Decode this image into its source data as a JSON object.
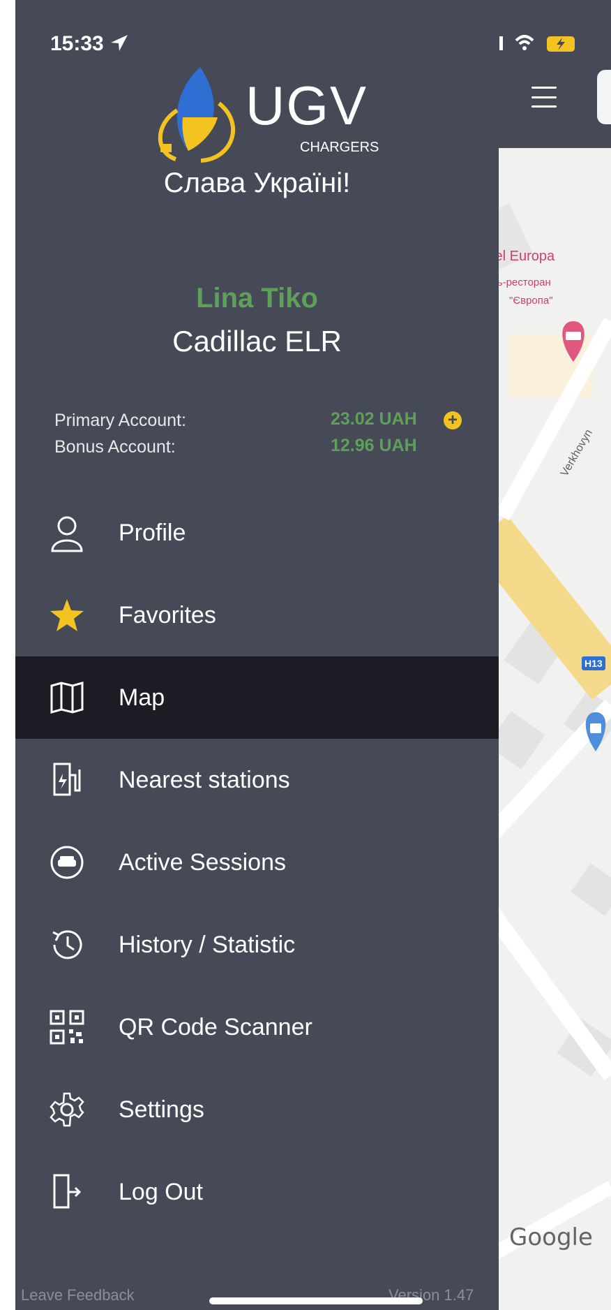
{
  "status": {
    "time": "15:33"
  },
  "brand": {
    "name": "UGV",
    "subtitle": "CHARGERS",
    "slogan": "Слава Україні!"
  },
  "user": {
    "name": "Lina Tiko",
    "car": "Cadillac ELR"
  },
  "accounts": {
    "primary_label": "Primary Account:",
    "primary_value": "23.02 UAH",
    "bonus_label": "Bonus Account:",
    "bonus_value": "12.96 UAH"
  },
  "menu": [
    {
      "label": "Profile",
      "icon": "user-icon"
    },
    {
      "label": "Favorites",
      "icon": "star-icon"
    },
    {
      "label": "Map",
      "icon": "map-icon",
      "active": true
    },
    {
      "label": "Nearest stations",
      "icon": "charging-station-icon"
    },
    {
      "label": "Active Sessions",
      "icon": "car-sync-icon"
    },
    {
      "label": "History / Statistic",
      "icon": "history-icon"
    },
    {
      "label": "QR Code Scanner",
      "icon": "qr-code-icon"
    },
    {
      "label": "Settings",
      "icon": "gear-icon"
    },
    {
      "label": "Log Out",
      "icon": "logout-icon"
    }
  ],
  "footer": {
    "feedback": "Leave Feedback",
    "version": "Version 1.47"
  },
  "map": {
    "hotel_name": "tel Europa",
    "hotel_sub1": "ль-ресторан",
    "hotel_sub2": "\"Європа\"",
    "street": "Verkhovyn",
    "road_badge": "H13",
    "attribution": "Google"
  },
  "colors": {
    "drawer_bg": "#454a56",
    "active_item_bg": "#1c1d24",
    "accent_green": "#5ea05a",
    "accent_yellow": "#f3c322"
  }
}
